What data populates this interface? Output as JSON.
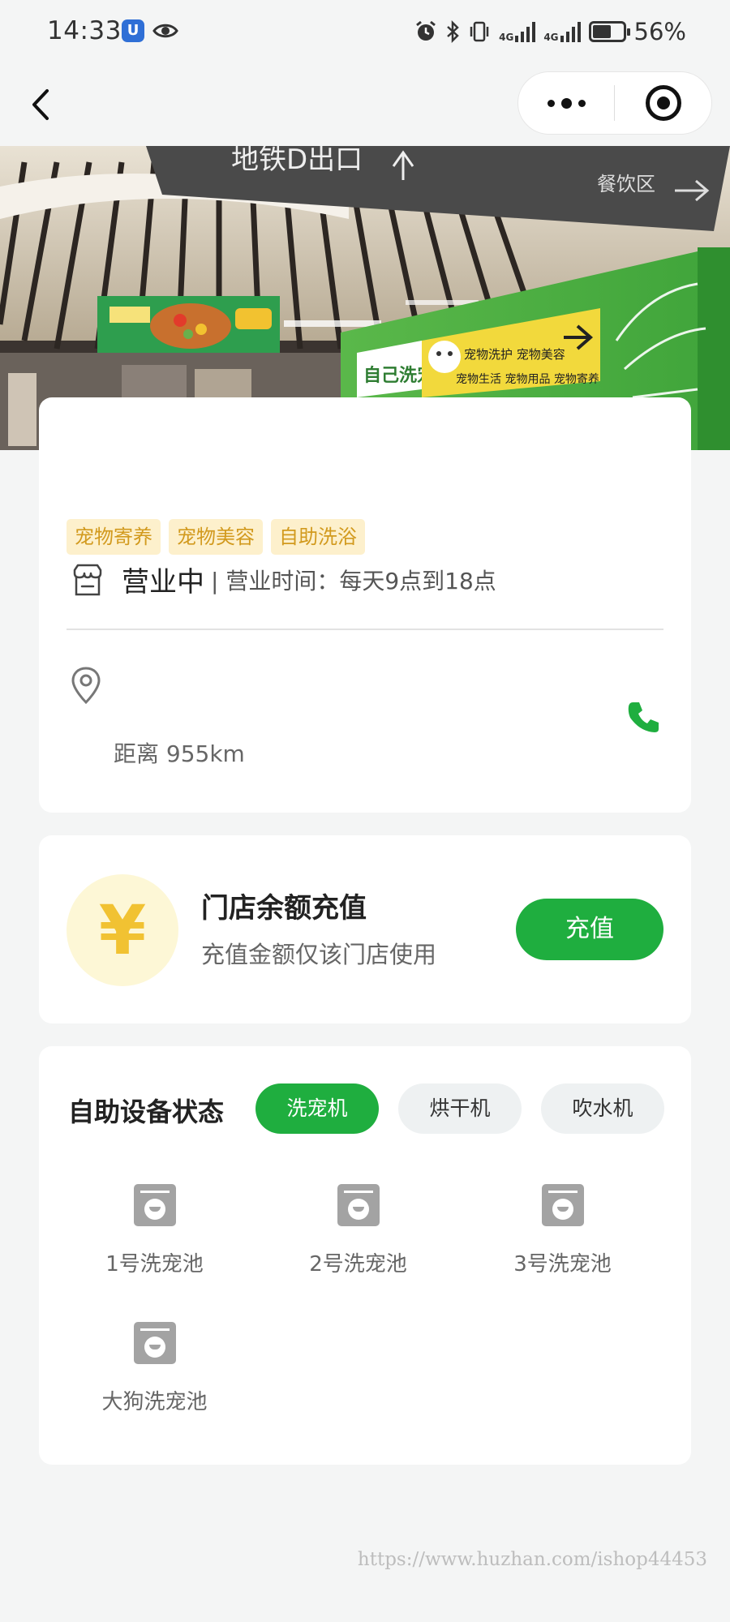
{
  "status_bar": {
    "time": "14:33",
    "net_label_1": "4G",
    "net_label_2": "4G",
    "battery": "56%",
    "icons": [
      "shield-badge-icon",
      "eye-icon",
      "alarm-icon",
      "bluetooth-icon",
      "vibrate-icon",
      "signal-icon",
      "battery-icon"
    ]
  },
  "nav": {
    "back_icon": "chevron-left-icon",
    "more_icon": "more-dots-icon",
    "close_icon": "target-icon"
  },
  "hero": {
    "sign_text": "地铁D出口",
    "sign_right": "餐饮区",
    "banner_title": "自己洗宠",
    "banner_line1": "宠物洗护  宠物美容",
    "banner_line2": "宠物生活  宠物用品  宠物寄养"
  },
  "store": {
    "tags": [
      "宠物寄养",
      "宠物美容",
      "自助洗浴"
    ],
    "open_status": "营业中",
    "hours": "| 营业时间：每天9点到18点",
    "distance": "距离 955km"
  },
  "recharge": {
    "symbol": "¥",
    "title": "门店余额充值",
    "subtitle": "充值金额仅该门店使用",
    "button": "充值"
  },
  "devices": {
    "title": "自助设备状态",
    "tabs": [
      {
        "label": "洗宠机",
        "active": true
      },
      {
        "label": "烘干机",
        "active": false
      },
      {
        "label": "吹水机",
        "active": false
      }
    ],
    "items": [
      "1号洗宠池",
      "2号洗宠池",
      "3号洗宠池",
      "大狗洗宠池"
    ]
  },
  "watermark": "https://www.huzhan.com/ishop44453",
  "colors": {
    "accent": "#1fae3f",
    "tag_bg": "#fdf0cc",
    "tag_text": "#d29a1e",
    "yen": "#f1c232"
  }
}
